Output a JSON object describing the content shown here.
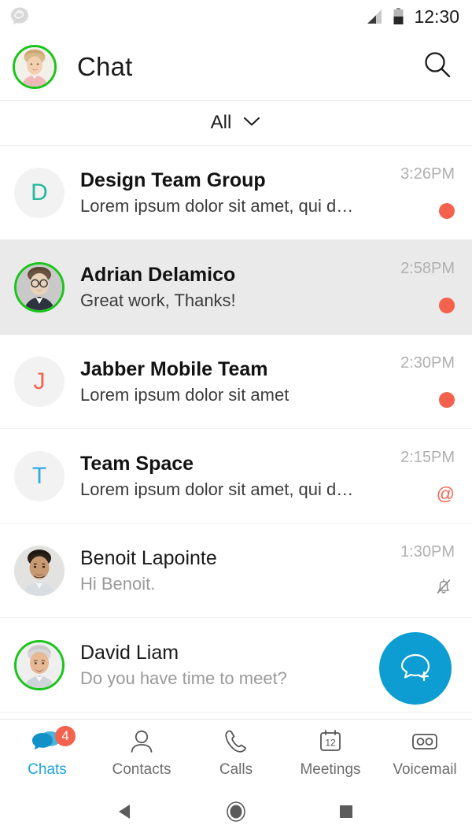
{
  "status_bar": {
    "notification_icon": "jabber-logo-icon",
    "signal_icon": "signal-bars-icon",
    "battery_icon": "battery-icon",
    "time": "12:30"
  },
  "app_bar": {
    "avatar": "user-avatar-photo",
    "avatar_presence_color": "#19C519",
    "title": "Chat",
    "search_icon": "search-icon"
  },
  "filter": {
    "label": "All",
    "chevron_icon": "chevron-down-icon"
  },
  "colors": {
    "accent_blue": "#0D9DD2",
    "nav_active": "#1FA3DE",
    "unread_red": "#F4624D",
    "presence_green": "#19C519",
    "selected_row": "#EAEAEA"
  },
  "chats": [
    {
      "name": "Design Team Group",
      "preview": "Lorem ipsum dolor sit amet, qui d…",
      "time": "3:26PM",
      "avatar_type": "initial",
      "initial": "D",
      "initial_color": "#26B99A",
      "presence": false,
      "badge": "dot",
      "unread": true,
      "selected": false
    },
    {
      "name": "Adrian Delamico",
      "preview": "Great work, Thanks!",
      "time": "2:58PM",
      "avatar_type": "photo",
      "initial": "",
      "initial_color": "",
      "presence": true,
      "badge": "dot",
      "unread": true,
      "selected": true
    },
    {
      "name": "Jabber Mobile Team",
      "preview": "Lorem ipsum dolor sit amet",
      "time": "2:30PM",
      "avatar_type": "initial",
      "initial": "J",
      "initial_color": "#F4624D",
      "presence": false,
      "badge": "dot",
      "unread": true,
      "selected": false
    },
    {
      "name": "Team Space",
      "preview": "Lorem ipsum dolor sit amet, qui d…",
      "time": "2:15PM",
      "avatar_type": "initial",
      "initial": "T",
      "initial_color": "#35A9E0",
      "presence": false,
      "badge": "mention",
      "badge_symbol": "@",
      "unread": true,
      "selected": false
    },
    {
      "name": "Benoit Lapointe",
      "preview": "Hi Benoit.",
      "time": "1:30PM",
      "avatar_type": "photo",
      "initial": "",
      "initial_color": "",
      "presence": false,
      "badge": "muted",
      "unread": false,
      "selected": false
    },
    {
      "name": "David Liam",
      "preview": "Do you have time to meet?",
      "time": "",
      "avatar_type": "photo",
      "initial": "",
      "initial_color": "",
      "presence": true,
      "badge": "none",
      "unread": false,
      "selected": false
    }
  ],
  "fab": {
    "icon": "new-chat-icon",
    "label": "New chat"
  },
  "bottom_nav": [
    {
      "label": "Chats",
      "icon": "chats-icon",
      "active": true,
      "badge": "4"
    },
    {
      "label": "Contacts",
      "icon": "contacts-icon",
      "active": false,
      "badge": ""
    },
    {
      "label": "Calls",
      "icon": "calls-icon",
      "active": false,
      "badge": ""
    },
    {
      "label": "Meetings",
      "icon": "meetings-calendar-icon",
      "active": false,
      "badge": "",
      "calendar_day": "12"
    },
    {
      "label": "Voicemail",
      "icon": "voicemail-icon",
      "active": false,
      "badge": ""
    }
  ],
  "android_nav": {
    "back": "back-triangle-icon",
    "home": "home-circle-icon",
    "recents": "recents-square-icon"
  }
}
